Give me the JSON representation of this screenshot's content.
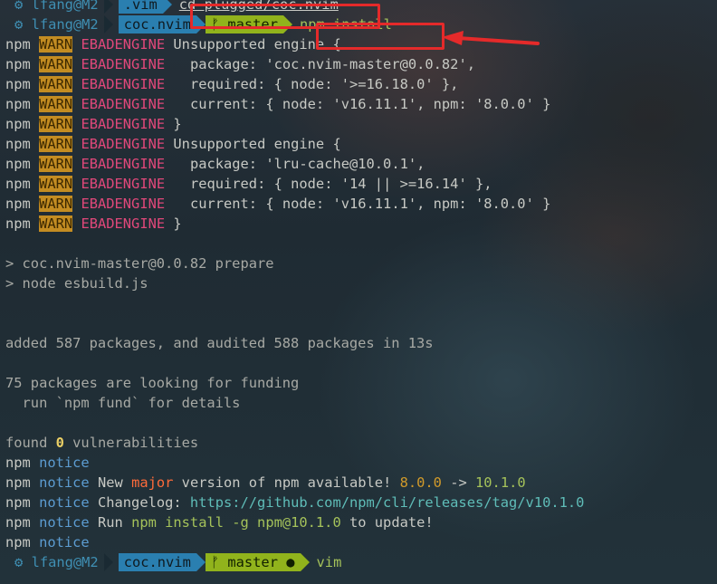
{
  "colors": {
    "accent_red": "#e52a2a",
    "warn_bg": "#c38c22",
    "error_pink": "#e0487a",
    "notice_blue": "#5c9cd1",
    "path_blue": "#2a7fb0",
    "branch_green": "#91b31c"
  },
  "prompt_top": {
    "icon": "gear-icon",
    "user": "lfang@M2",
    "dir": ".vim",
    "command": "cd plugged/coc.nvim"
  },
  "prompt_second": {
    "icon": "gear-icon",
    "user": "lfang@M2",
    "dir": "coc.nvim",
    "branch_icon": "git-branch-icon",
    "branch": "master",
    "command": "npm install"
  },
  "warnings": [
    {
      "npm": "npm",
      "level": "WARN",
      "code": "EBADENGINE",
      "msg": "Unsupported engine {"
    },
    {
      "npm": "npm",
      "level": "WARN",
      "code": "EBADENGINE",
      "msg": "  package: 'coc.nvim-master@0.0.82',"
    },
    {
      "npm": "npm",
      "level": "WARN",
      "code": "EBADENGINE",
      "msg": "  required: { node: '>=16.18.0' },"
    },
    {
      "npm": "npm",
      "level": "WARN",
      "code": "EBADENGINE",
      "msg": "  current: { node: 'v16.11.1', npm: '8.0.0' }"
    },
    {
      "npm": "npm",
      "level": "WARN",
      "code": "EBADENGINE",
      "msg": "}"
    },
    {
      "npm": "npm",
      "level": "WARN",
      "code": "EBADENGINE",
      "msg": "Unsupported engine {"
    },
    {
      "npm": "npm",
      "level": "WARN",
      "code": "EBADENGINE",
      "msg": "  package: 'lru-cache@10.0.1',"
    },
    {
      "npm": "npm",
      "level": "WARN",
      "code": "EBADENGINE",
      "msg": "  required: { node: '14 || >=16.14' },"
    },
    {
      "npm": "npm",
      "level": "WARN",
      "code": "EBADENGINE",
      "msg": "  current: { node: 'v16.11.1', npm: '8.0.0' }"
    },
    {
      "npm": "npm",
      "level": "WARN",
      "code": "EBADENGINE",
      "msg": "}"
    }
  ],
  "prepare": {
    "line1": "> coc.nvim-master@0.0.82 prepare",
    "line2": "> node esbuild.js"
  },
  "summary": {
    "added": "added 587 packages, and audited 588 packages in 13s",
    "funding1": "75 packages are looking for funding",
    "funding2": "  run `npm fund` for details",
    "found_prefix": "found ",
    "found_count": "0",
    "found_suffix": " vulnerabilities"
  },
  "notices": {
    "npm": "npm",
    "label": "notice",
    "l2_a": "New ",
    "l2_major": "major",
    "l2_b": " version of npm available! ",
    "l2_old": "8.0.0",
    "l2_arrow": " -> ",
    "l2_new": "10.1.0",
    "l3_a": "Changelog: ",
    "l3_url": "https://github.com/npm/cli/releases/tag/v10.1.0",
    "l4_a": "Run ",
    "l4_cmd": "npm install -g npm@10.1.0",
    "l4_b": " to update!"
  },
  "prompt_bottom": {
    "icon": "gear-icon",
    "user": "lfang@M2",
    "dir": "coc.nvim",
    "branch_icon": "git-branch-icon",
    "branch": "master",
    "dirty": "●",
    "command": "vim"
  }
}
